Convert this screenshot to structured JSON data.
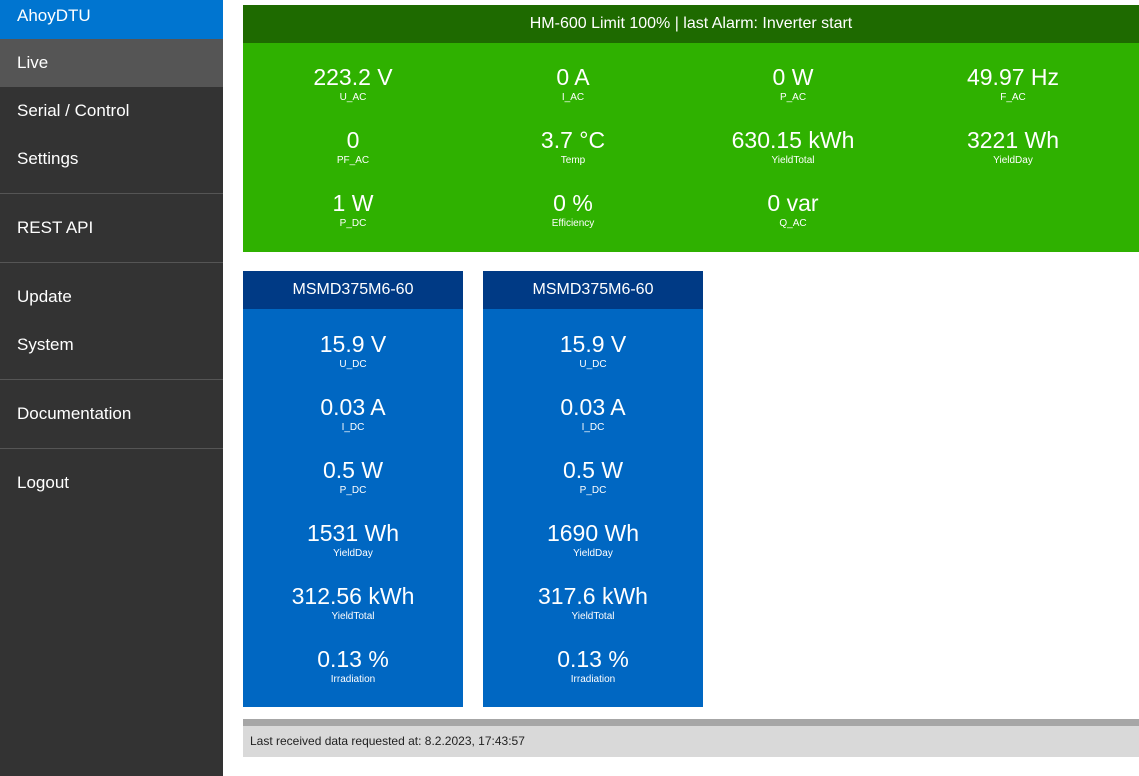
{
  "sidebar": {
    "brand": "AhoyDTU",
    "items": [
      {
        "label": "Live",
        "active": true
      },
      {
        "label": "Serial / Control"
      },
      {
        "label": "Settings"
      },
      {
        "label": "REST API"
      },
      {
        "label": "Update"
      },
      {
        "label": "System"
      },
      {
        "label": "Documentation"
      },
      {
        "label": "Logout"
      }
    ]
  },
  "inverter": {
    "header": "HM-600 Limit 100% | last Alarm: Inverter start",
    "values": [
      {
        "value": "223.2 V",
        "label": "U_AC"
      },
      {
        "value": "0 A",
        "label": "I_AC"
      },
      {
        "value": "0 W",
        "label": "P_AC"
      },
      {
        "value": "49.97 Hz",
        "label": "F_AC"
      },
      {
        "value": "0",
        "label": "PF_AC"
      },
      {
        "value": "3.7 °C",
        "label": "Temp"
      },
      {
        "value": "630.15 kWh",
        "label": "YieldTotal"
      },
      {
        "value": "3221 Wh",
        "label": "YieldDay"
      },
      {
        "value": "1 W",
        "label": "P_DC"
      },
      {
        "value": "0 %",
        "label": "Efficiency"
      },
      {
        "value": "0 var",
        "label": "Q_AC"
      }
    ]
  },
  "modules": [
    {
      "name": "MSMD375M6-60",
      "values": [
        {
          "value": "15.9 V",
          "label": "U_DC"
        },
        {
          "value": "0.03 A",
          "label": "I_DC"
        },
        {
          "value": "0.5 W",
          "label": "P_DC"
        },
        {
          "value": "1531 Wh",
          "label": "YieldDay"
        },
        {
          "value": "312.56 kWh",
          "label": "YieldTotal"
        },
        {
          "value": "0.13 %",
          "label": "Irradiation"
        }
      ]
    },
    {
      "name": "MSMD375M6-60",
      "values": [
        {
          "value": "15.9 V",
          "label": "U_DC"
        },
        {
          "value": "0.03 A",
          "label": "I_DC"
        },
        {
          "value": "0.5 W",
          "label": "P_DC"
        },
        {
          "value": "1690 Wh",
          "label": "YieldDay"
        },
        {
          "value": "317.6 kWh",
          "label": "YieldTotal"
        },
        {
          "value": "0.13 %",
          "label": "Irradiation"
        }
      ]
    }
  ],
  "footer": {
    "text": "Last received data requested at: 8.2.2023, 17:43:57"
  },
  "colors": {
    "sidebar": "#333333",
    "brand": "#0075d0",
    "inverter_bg": "#2fb100",
    "inverter_header": "#1e6a00",
    "module_bg": "#0067c2",
    "module_header": "#003a85"
  }
}
